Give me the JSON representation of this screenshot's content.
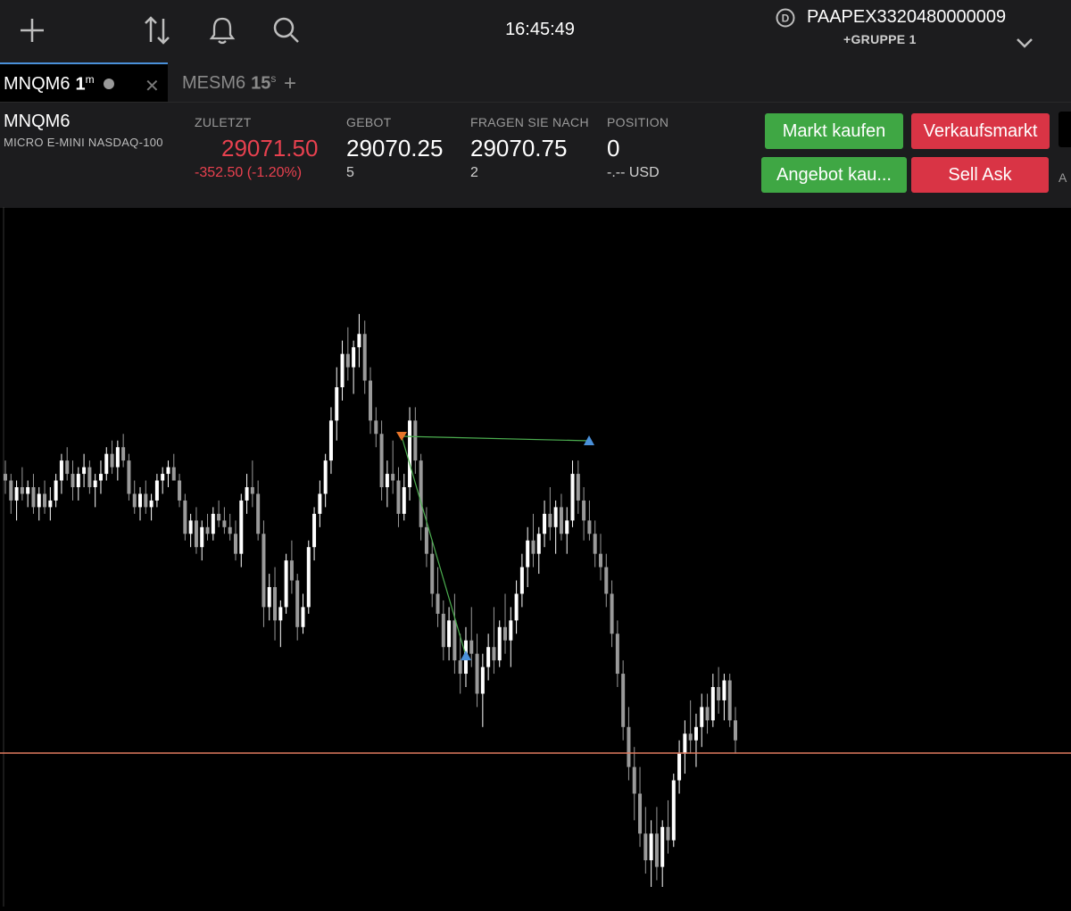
{
  "topbar": {
    "icons": [
      "add-icon",
      "swap-icon",
      "bell-icon",
      "search-icon"
    ],
    "clock": "16:45:49",
    "account_name": "PAAPEX3320480000009",
    "account_group": "+GRUPPE 1",
    "account_badge": "D"
  },
  "tabs": [
    {
      "symbol": "MNQM6",
      "timeframe": "1",
      "unit": "m",
      "active": true
    },
    {
      "symbol": "MESM6",
      "timeframe": "15",
      "unit": "s",
      "active": false
    }
  ],
  "quote": {
    "symbol": "MNQM6",
    "description": "MICRO E-MINI NASDAQ-100",
    "last_label": "ZULETZT",
    "last_value": "29071.50",
    "last_change": "-352.50 (-1.20%)",
    "bid_label": "GEBOT",
    "bid_value": "29070.25",
    "bid_size": "5",
    "ask_label": "FRAGEN SIE NACH",
    "ask_value": "29070.75",
    "ask_size": "2",
    "position_label": "POSITION",
    "position_value": "0",
    "position_pnl": "-.-- USD"
  },
  "buttons": {
    "market_buy": "Markt kaufen",
    "market_sell": "Verkaufsmarkt",
    "bid_buy": "Angebot kau...",
    "sell_ask": "Sell Ask",
    "edge_label": "A"
  },
  "colors": {
    "up": "#ffffff",
    "down": "#9a9a9a",
    "price_line": "#e07a5f",
    "drawing": "#4caf50",
    "marker_blue": "#4a90d9",
    "marker_orange": "#e8752a",
    "buy_green": "#3fa744",
    "sell_red": "#d93445",
    "loss_red": "#e8414f"
  },
  "chart_data": {
    "type": "candlestick",
    "note_price_line": "last price horizontal line",
    "series": [
      {
        "name": "",
        "ohlc": [
          [
            0.5,
            0.52,
            0.47,
            0.49
          ],
          [
            0.49,
            0.5,
            0.44,
            0.46
          ],
          [
            0.46,
            0.49,
            0.43,
            0.48
          ],
          [
            0.48,
            0.51,
            0.46,
            0.47
          ],
          [
            0.47,
            0.49,
            0.45,
            0.48
          ],
          [
            0.48,
            0.5,
            0.44,
            0.45
          ],
          [
            0.45,
            0.48,
            0.43,
            0.47
          ],
          [
            0.47,
            0.49,
            0.44,
            0.45
          ],
          [
            0.45,
            0.48,
            0.43,
            0.46
          ],
          [
            0.46,
            0.5,
            0.45,
            0.49
          ],
          [
            0.49,
            0.53,
            0.47,
            0.52
          ],
          [
            0.52,
            0.54,
            0.49,
            0.5
          ],
          [
            0.5,
            0.52,
            0.46,
            0.48
          ],
          [
            0.48,
            0.51,
            0.46,
            0.5
          ],
          [
            0.5,
            0.53,
            0.48,
            0.51
          ],
          [
            0.51,
            0.52,
            0.47,
            0.48
          ],
          [
            0.48,
            0.5,
            0.45,
            0.49
          ],
          [
            0.49,
            0.52,
            0.47,
            0.5
          ],
          [
            0.5,
            0.54,
            0.49,
            0.53
          ],
          [
            0.53,
            0.55,
            0.5,
            0.51
          ],
          [
            0.51,
            0.55,
            0.49,
            0.54
          ],
          [
            0.54,
            0.56,
            0.51,
            0.52
          ],
          [
            0.52,
            0.53,
            0.46,
            0.47
          ],
          [
            0.47,
            0.49,
            0.44,
            0.45
          ],
          [
            0.45,
            0.48,
            0.43,
            0.47
          ],
          [
            0.47,
            0.49,
            0.44,
            0.45
          ],
          [
            0.45,
            0.47,
            0.43,
            0.46
          ],
          [
            0.46,
            0.5,
            0.45,
            0.49
          ],
          [
            0.49,
            0.51,
            0.47,
            0.5
          ],
          [
            0.5,
            0.52,
            0.48,
            0.51
          ],
          [
            0.51,
            0.53,
            0.49,
            0.49
          ],
          [
            0.49,
            0.5,
            0.45,
            0.46
          ],
          [
            0.46,
            0.47,
            0.4,
            0.41
          ],
          [
            0.41,
            0.44,
            0.39,
            0.43
          ],
          [
            0.43,
            0.45,
            0.38,
            0.39
          ],
          [
            0.39,
            0.43,
            0.37,
            0.42
          ],
          [
            0.42,
            0.44,
            0.4,
            0.41
          ],
          [
            0.41,
            0.45,
            0.4,
            0.44
          ],
          [
            0.44,
            0.46,
            0.42,
            0.43
          ],
          [
            0.43,
            0.45,
            0.41,
            0.42
          ],
          [
            0.42,
            0.44,
            0.4,
            0.41
          ],
          [
            0.41,
            0.43,
            0.37,
            0.38
          ],
          [
            0.38,
            0.47,
            0.36,
            0.46
          ],
          [
            0.46,
            0.5,
            0.44,
            0.48
          ],
          [
            0.48,
            0.52,
            0.45,
            0.47
          ],
          [
            0.47,
            0.49,
            0.4,
            0.41
          ],
          [
            0.41,
            0.43,
            0.27,
            0.3
          ],
          [
            0.3,
            0.35,
            0.28,
            0.33
          ],
          [
            0.33,
            0.36,
            0.25,
            0.28
          ],
          [
            0.28,
            0.31,
            0.24,
            0.3
          ],
          [
            0.3,
            0.38,
            0.29,
            0.37
          ],
          [
            0.37,
            0.4,
            0.32,
            0.34
          ],
          [
            0.34,
            0.35,
            0.25,
            0.27
          ],
          [
            0.27,
            0.32,
            0.26,
            0.3
          ],
          [
            0.3,
            0.4,
            0.29,
            0.39
          ],
          [
            0.39,
            0.45,
            0.37,
            0.44
          ],
          [
            0.44,
            0.49,
            0.42,
            0.47
          ],
          [
            0.47,
            0.53,
            0.45,
            0.52
          ],
          [
            0.52,
            0.6,
            0.5,
            0.58
          ],
          [
            0.58,
            0.66,
            0.55,
            0.63
          ],
          [
            0.63,
            0.7,
            0.61,
            0.68
          ],
          [
            0.68,
            0.72,
            0.64,
            0.66
          ],
          [
            0.66,
            0.7,
            0.62,
            0.69
          ],
          [
            0.69,
            0.74,
            0.66,
            0.71
          ],
          [
            0.71,
            0.73,
            0.62,
            0.64
          ],
          [
            0.64,
            0.66,
            0.56,
            0.58
          ],
          [
            0.58,
            0.6,
            0.54,
            0.56
          ],
          [
            0.56,
            0.58,
            0.46,
            0.48
          ],
          [
            0.48,
            0.52,
            0.45,
            0.5
          ],
          [
            0.5,
            0.55,
            0.47,
            0.49
          ],
          [
            0.49,
            0.51,
            0.42,
            0.44
          ],
          [
            0.44,
            0.5,
            0.43,
            0.48
          ],
          [
            0.48,
            0.6,
            0.46,
            0.58
          ],
          [
            0.58,
            0.6,
            0.5,
            0.52
          ],
          [
            0.52,
            0.53,
            0.4,
            0.42
          ],
          [
            0.42,
            0.45,
            0.36,
            0.38
          ],
          [
            0.38,
            0.4,
            0.3,
            0.32
          ],
          [
            0.32,
            0.36,
            0.27,
            0.29
          ],
          [
            0.29,
            0.31,
            0.22,
            0.24
          ],
          [
            0.24,
            0.3,
            0.22,
            0.28
          ],
          [
            0.28,
            0.32,
            0.2,
            0.22
          ],
          [
            0.22,
            0.26,
            0.17,
            0.2
          ],
          [
            0.2,
            0.27,
            0.18,
            0.25
          ],
          [
            0.25,
            0.3,
            0.21,
            0.23
          ],
          [
            0.23,
            0.26,
            0.15,
            0.17
          ],
          [
            0.17,
            0.23,
            0.12,
            0.21
          ],
          [
            0.21,
            0.26,
            0.19,
            0.24
          ],
          [
            0.24,
            0.3,
            0.2,
            0.22
          ],
          [
            0.22,
            0.28,
            0.21,
            0.27
          ],
          [
            0.27,
            0.32,
            0.23,
            0.25
          ],
          [
            0.25,
            0.3,
            0.21,
            0.28
          ],
          [
            0.28,
            0.34,
            0.26,
            0.32
          ],
          [
            0.32,
            0.38,
            0.3,
            0.36
          ],
          [
            0.36,
            0.42,
            0.33,
            0.4
          ],
          [
            0.4,
            0.44,
            0.36,
            0.38
          ],
          [
            0.38,
            0.42,
            0.35,
            0.41
          ],
          [
            0.41,
            0.46,
            0.39,
            0.44
          ],
          [
            0.44,
            0.48,
            0.4,
            0.42
          ],
          [
            0.42,
            0.46,
            0.38,
            0.45
          ],
          [
            0.45,
            0.47,
            0.4,
            0.41
          ],
          [
            0.41,
            0.45,
            0.38,
            0.43
          ],
          [
            0.43,
            0.52,
            0.42,
            0.5
          ],
          [
            0.5,
            0.52,
            0.44,
            0.46
          ],
          [
            0.46,
            0.48,
            0.4,
            0.43
          ],
          [
            0.43,
            0.46,
            0.4,
            0.41
          ],
          [
            0.41,
            0.43,
            0.36,
            0.38
          ],
          [
            0.38,
            0.41,
            0.34,
            0.36
          ],
          [
            0.36,
            0.38,
            0.3,
            0.32
          ],
          [
            0.32,
            0.34,
            0.24,
            0.26
          ],
          [
            0.26,
            0.28,
            0.18,
            0.2
          ],
          [
            0.2,
            0.22,
            0.1,
            0.12
          ],
          [
            0.12,
            0.15,
            0.04,
            0.06
          ],
          [
            0.06,
            0.09,
            -0.02,
            0.02
          ],
          [
            0.02,
            0.06,
            -0.06,
            -0.04
          ],
          [
            -0.04,
            0.0,
            -0.1,
            -0.08
          ],
          [
            -0.08,
            -0.02,
            -0.12,
            -0.04
          ],
          [
            -0.04,
            0.0,
            -0.11,
            -0.09
          ],
          [
            -0.09,
            -0.02,
            -0.12,
            -0.03
          ],
          [
            -0.03,
            0.01,
            -0.07,
            -0.05
          ],
          [
            -0.05,
            0.05,
            -0.06,
            0.04
          ],
          [
            0.04,
            0.1,
            0.02,
            0.08
          ],
          [
            0.08,
            0.13,
            0.05,
            0.11
          ],
          [
            0.11,
            0.16,
            0.08,
            0.1
          ],
          [
            0.1,
            0.14,
            0.06,
            0.12
          ],
          [
            0.12,
            0.17,
            0.09,
            0.15
          ],
          [
            0.15,
            0.17,
            0.11,
            0.13
          ],
          [
            0.13,
            0.2,
            0.12,
            0.18
          ],
          [
            0.18,
            0.21,
            0.14,
            0.16
          ],
          [
            0.16,
            0.2,
            0.13,
            0.19
          ],
          [
            0.19,
            0.2,
            0.12,
            0.13
          ],
          [
            0.13,
            0.15,
            0.08,
            0.1
          ]
        ]
      }
    ]
  }
}
